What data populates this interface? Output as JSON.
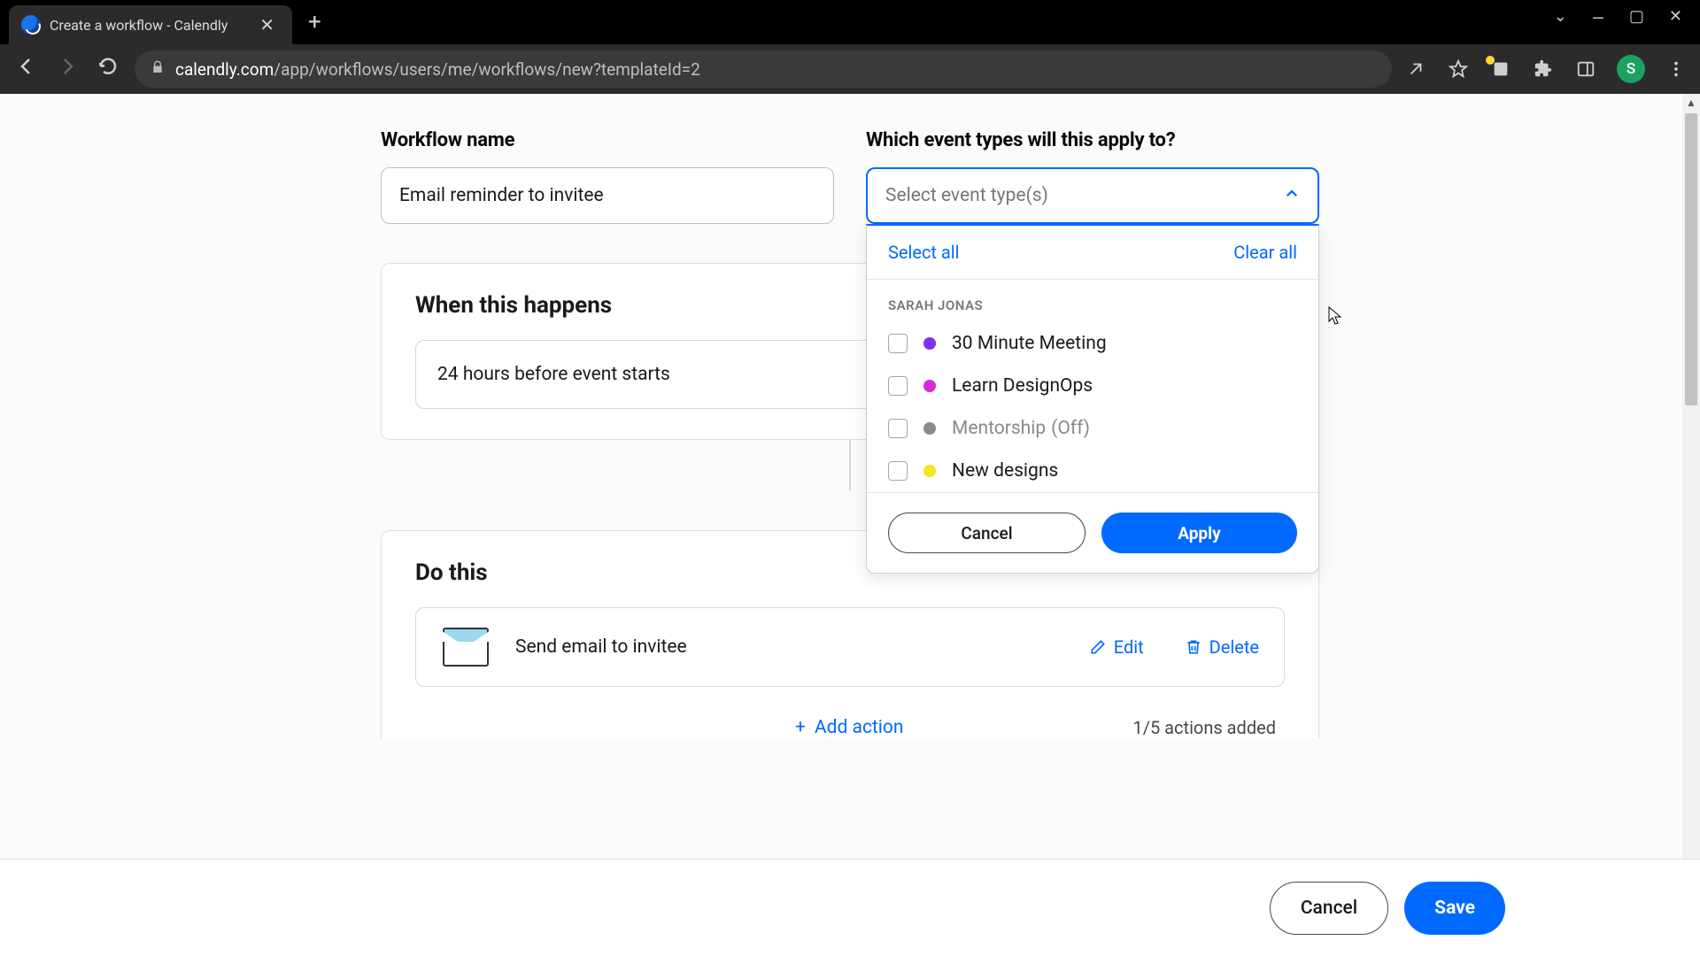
{
  "browser": {
    "tab_title": "Create a workflow - Calendly",
    "url_host": "calendly.com",
    "url_path": "/app/workflows/users/me/workflows/new?templateId=2",
    "avatar_letter": "S"
  },
  "page": {
    "workflow_name_label": "Workflow name",
    "workflow_name_value": "Email reminder to invitee",
    "event_types_label": "Which event types will this apply to?",
    "event_types_placeholder": "Select event type(s)",
    "dropdown": {
      "select_all": "Select all",
      "clear_all": "Clear all",
      "owner": "SARAH JONAS",
      "options": [
        {
          "label": "30 Minute Meeting",
          "color": "#7b2ff7",
          "off": false
        },
        {
          "label": "Learn DesignOps",
          "color": "#d429d4",
          "off": false
        },
        {
          "label": "Mentorship",
          "suffix": "(Off)",
          "color": "#8a8a8a",
          "off": true
        },
        {
          "label": "New designs",
          "color": "#f4e61e",
          "off": false
        }
      ],
      "cancel": "Cancel",
      "apply": "Apply"
    },
    "when_title": "When this happens",
    "trigger_text": "24 hours before event starts",
    "do_title": "Do this",
    "action_label": "Send email to invitee",
    "edit": "Edit",
    "delete": "Delete",
    "add_action": "Add action",
    "actions_count": "1/5 actions added",
    "footer_cancel": "Cancel",
    "footer_save": "Save"
  }
}
